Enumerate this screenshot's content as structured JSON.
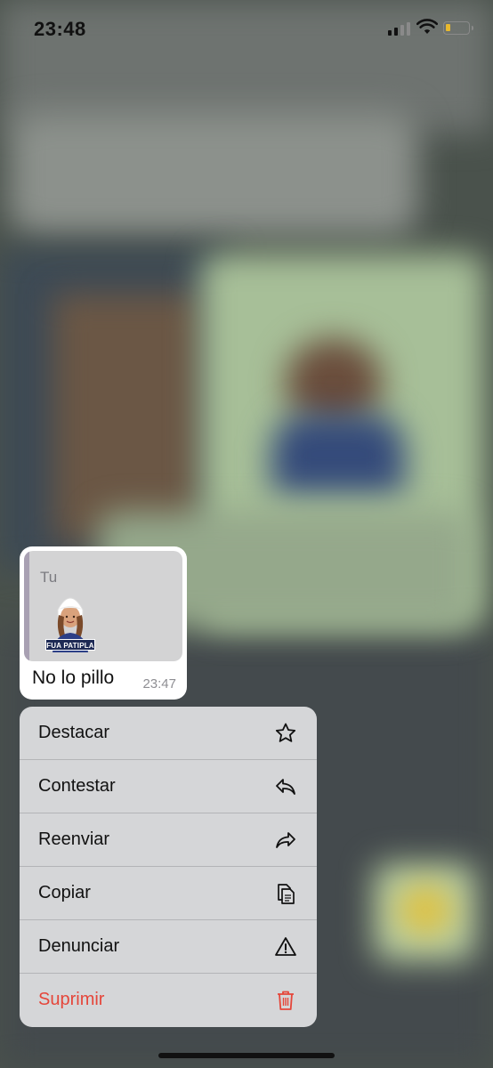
{
  "status_bar": {
    "time": "23:48",
    "battery_color": "#e8b92e"
  },
  "message": {
    "quoted_author": "Tu",
    "sticker_text": "FUA PATIPLA",
    "text": "No lo pillo",
    "time": "23:47"
  },
  "menu": {
    "items": [
      {
        "label": "Destacar",
        "icon": "star-icon"
      },
      {
        "label": "Contestar",
        "icon": "reply-icon"
      },
      {
        "label": "Reenviar",
        "icon": "forward-icon"
      },
      {
        "label": "Copiar",
        "icon": "copy-icon"
      },
      {
        "label": "Denunciar",
        "icon": "warning-icon"
      },
      {
        "label": "Suprimir",
        "icon": "trash-icon",
        "color": "#e5463a"
      }
    ]
  }
}
